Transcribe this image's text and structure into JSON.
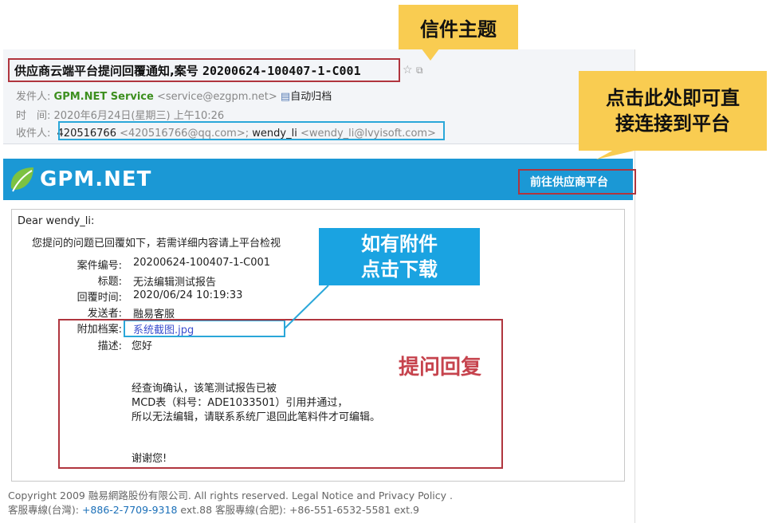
{
  "subject": {
    "prefix": "供应商云端平台提问回覆通知,案号 ",
    "case_no": "20200624-100407-1-C001"
  },
  "meta": {
    "from_label": "发件人:",
    "from_name": "GPM.NET Service",
    "from_addr": " <service@ezgpm.net>",
    "archive_label": "自动归档",
    "time_label": "时　间:",
    "time_value": "2020年6月24日(星期三) 上午10:26",
    "to_label": "收件人:",
    "to_name1": "420516766",
    "to_addr1": " <420516766@qq.com>; ",
    "to_name2": "wendy_li",
    "to_addr2": " <wendy_li@lvyisoft.com>"
  },
  "banner": {
    "logo_text": "GPM.NET",
    "portal_link": "前往供应商平台"
  },
  "message": {
    "greeting": "Dear wendy_li:",
    "intro": "您提问的问题已回覆如下，若需详细内容请上平台检视",
    "fields": [
      {
        "label": "案件编号:",
        "value": "20200624-100407-1-C001"
      },
      {
        "label": "标题:",
        "value": "无法编辑测试报告"
      },
      {
        "label": "回覆时间:",
        "value": "2020/06/24 10:19:33"
      },
      {
        "label": "发送者:",
        "value": "融易客服"
      },
      {
        "label": "附加档案:",
        "value": "系统截图.jpg"
      },
      {
        "label": "描述:",
        "value": "您好"
      }
    ],
    "body1": "经查询确认，该笔测试报告已被",
    "body2": "MCD表（料号：ADE1033501）引用并通过，",
    "body3": "所以无法编辑，请联系系统厂退回此笔料件才可编辑。",
    "thanks": "谢谢您!"
  },
  "footer": {
    "line1": "Copyright 2009 融易網路股份有限公司. All rights reserved. Legal Notice and Privacy Policy .",
    "line2_a": "客服專線(台灣): ",
    "line2_tw": "+886-2-7709-9318",
    "line2_b": " ext.88 客服專線(合肥):  +86-551-6532-5581 ext.9"
  },
  "annotations": {
    "subject_callout": "信件主题",
    "portal_callout_1": "点击此处即可直",
    "portal_callout_2": "接连接到平台",
    "attach_callout_1": "如有附件",
    "attach_callout_2": "点击下载",
    "reply_label": "提问回复"
  },
  "colors": {
    "banner_blue": "#1b98d5",
    "sender_green": "#3d8f1f",
    "annotation_red": "#b0353e",
    "annotation_cyan": "#2aa7d9",
    "callout_yellow": "#f9cc51"
  }
}
